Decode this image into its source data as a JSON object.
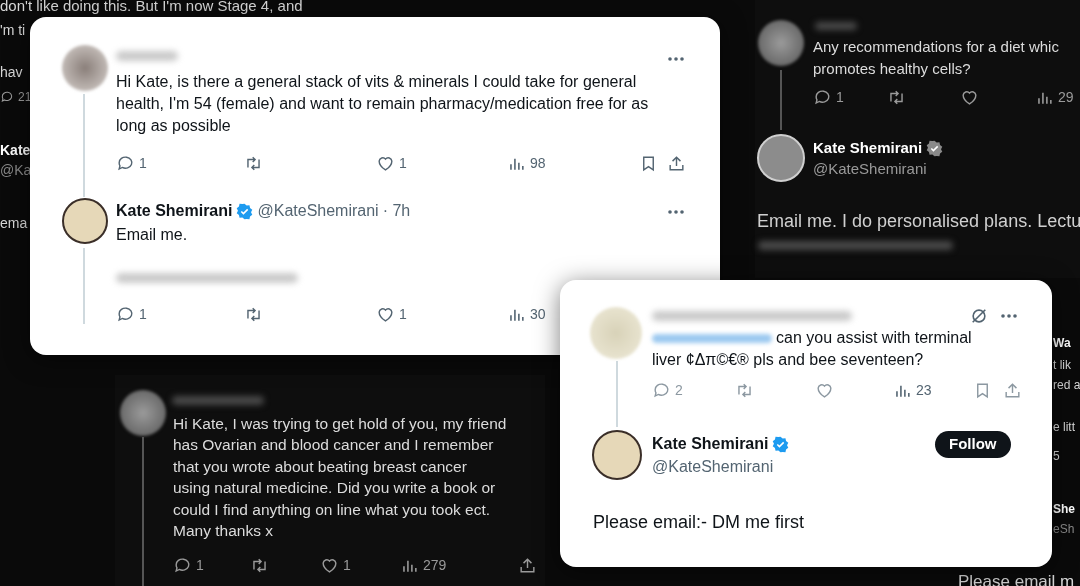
{
  "top_fragment": "don't like doing this. But I'm now Stage 4, and",
  "left_fragments": [
    {
      "kind": "text",
      "text": "'m ti"
    },
    {
      "kind": "text",
      "text": "hav"
    },
    {
      "kind": "reply",
      "text": "21"
    },
    {
      "kind": "name",
      "text": "Kate"
    },
    {
      "kind": "handle",
      "text": "@Ka"
    },
    {
      "kind": "text",
      "text": "ema"
    }
  ],
  "card_1": {
    "question": {
      "text": "Hi Kate, is there a general stack of vits & minerals I could take for general\nhealth, I'm 54 (female) and want to remain pharmacy/medication free for as\nlong as possible",
      "actions": [
        {
          "kind": "reply",
          "count": "1",
          "faded": false
        },
        {
          "kind": "repost",
          "faded": false
        },
        {
          "kind": "like",
          "count": "1",
          "faded": false
        },
        {
          "kind": "views",
          "count": "98",
          "faded": false
        },
        {
          "kind": "bookmark",
          "faded": false
        },
        {
          "kind": "share",
          "faded": false
        }
      ]
    },
    "reply": {
      "name": "Kate Shemirani",
      "verified": true,
      "handle": "@KateShemirani",
      "time": "· 7h",
      "text": "Email me.",
      "actions": [
        {
          "kind": "reply",
          "count": "1",
          "faded": false
        },
        {
          "kind": "repost",
          "faded": false
        },
        {
          "kind": "like",
          "count": "1",
          "faded": false
        },
        {
          "kind": "views",
          "count": "30",
          "faded": false
        }
      ]
    }
  },
  "panel_top_right": {
    "question": {
      "lines": [
        "Any recommendations for a diet whic",
        "promotes healthy cells?"
      ],
      "actions": [
        {
          "kind": "reply",
          "count": "1",
          "faded": false
        },
        {
          "kind": "repost",
          "faded": false
        },
        {
          "kind": "like",
          "faded": false
        },
        {
          "kind": "views",
          "count": "29",
          "faded": false
        }
      ]
    },
    "reply": {
      "name": "Kate Shemirani",
      "verified": true,
      "handle": "@KateShemirani",
      "text": "Email me. I do personalised plans. Lectu"
    }
  },
  "panel_bottom": {
    "question": {
      "text": "Hi Kate, I was trying to get hold of you, my friend\nhas Ovarian and blood cancer and I remember\nthat you wrote about beating breast cancer\nusing natural medicine. Did you write a book or\ncould I find anything on line what you took ect.\nMany thanks x",
      "actions": [
        {
          "kind": "reply",
          "count": "1",
          "faded": false
        },
        {
          "kind": "repost",
          "faded": false
        },
        {
          "kind": "like",
          "count": "1",
          "faded": false
        },
        {
          "kind": "views",
          "count": "279",
          "faded": false
        },
        {
          "kind": "share",
          "faded": false
        }
      ]
    }
  },
  "card_2": {
    "question": {
      "text": "can you assist with terminal\nliver ¢Δπ©€® pls and bee seventeen?",
      "actions": [
        {
          "kind": "reply",
          "count": "2",
          "faded": true
        },
        {
          "kind": "repost",
          "faded": true
        },
        {
          "kind": "like",
          "faded": true
        },
        {
          "kind": "views",
          "count": "23",
          "faded": false
        },
        {
          "kind": "bookmark",
          "faded": true
        },
        {
          "kind": "share",
          "faded": true
        }
      ]
    },
    "reply": {
      "name": "Kate Shemirani",
      "verified": true,
      "handle": "@KateShemirani",
      "follow_button": "Follow",
      "text": "Please email:- DM me first"
    }
  },
  "right_fragments": [
    {
      "kind": "name",
      "text": "Wa"
    },
    {
      "kind": "text",
      "text": "t lik"
    },
    {
      "kind": "text",
      "text": "red a"
    },
    {
      "kind": "text",
      "text": "e litt"
    },
    {
      "kind": "text",
      "text": "5"
    },
    {
      "kind": "name",
      "text": "She"
    },
    {
      "kind": "handle",
      "text": "eSh"
    }
  ],
  "bottom_fragment": "Please email m"
}
